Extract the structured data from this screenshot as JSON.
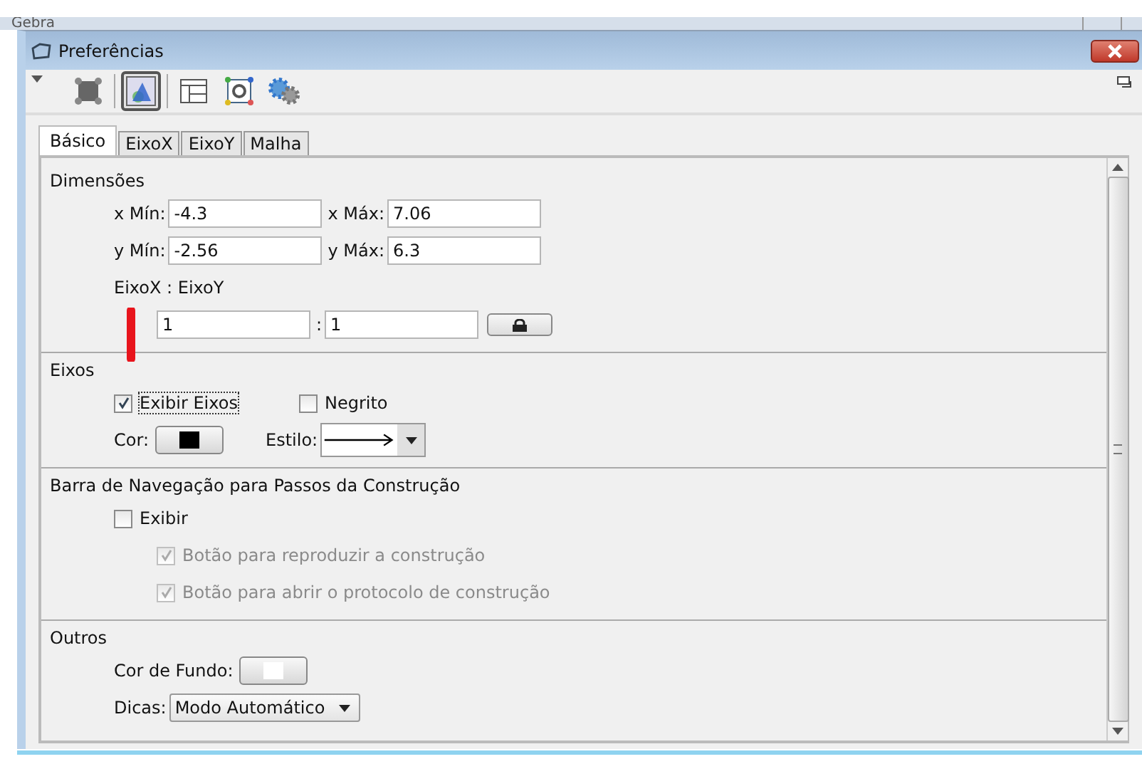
{
  "app_title": "Gebra",
  "window": {
    "title": "Preferências"
  },
  "toolbar": [
    {
      "kind": "points",
      "selected": false
    },
    {
      "kind": "graphics",
      "selected": true
    },
    {
      "kind": "layout",
      "selected": false
    },
    {
      "kind": "defaults",
      "selected": false
    },
    {
      "kind": "advanced",
      "selected": false
    }
  ],
  "tabs": [
    {
      "label": "Básico",
      "selected": true
    },
    {
      "label": "EixoX",
      "selected": false
    },
    {
      "label": "EixoY",
      "selected": false
    },
    {
      "label": "Malha",
      "selected": false
    }
  ],
  "sections": [
    {
      "title": "Dimensões",
      "rows": [
        {
          "kind": "main",
          "items": [
            {
              "kind": "label",
              "text": "x Mín:"
            },
            {
              "kind": "field",
              "value": "-4.3"
            },
            {
              "kind": "label",
              "text": "x Máx:"
            },
            {
              "kind": "field",
              "value": "7.06"
            }
          ]
        },
        {
          "kind": "main",
          "items": [
            {
              "kind": "label",
              "text": "y Mín:"
            },
            {
              "kind": "field",
              "value": "-2.56"
            },
            {
              "kind": "label",
              "text": "y Máx:"
            },
            {
              "kind": "field",
              "value": "6.3"
            }
          ]
        },
        {
          "kind": "main",
          "items": [
            {
              "kind": "label",
              "text": "EixoX : EixoY"
            }
          ]
        },
        {
          "kind": "sub",
          "items": [
            {
              "kind": "field",
              "value": "1"
            },
            {
              "kind": "label",
              "text": ":"
            },
            {
              "kind": "field",
              "value": "1"
            },
            {
              "kind": "lock"
            }
          ]
        }
      ]
    },
    {
      "title": "Eixos",
      "rows": [
        {
          "kind": "main",
          "items": [
            {
              "kind": "checkbox",
              "text": "Exibir Eixos",
              "checked": true,
              "disabled": false,
              "focused": true
            },
            {
              "kind": "checkbox",
              "text": "Negrito",
              "checked": false,
              "disabled": false,
              "focused": false
            }
          ]
        },
        {
          "kind": "main",
          "items": [
            {
              "kind": "label",
              "text": "Cor:"
            },
            {
              "kind": "color",
              "color": "#000000"
            },
            {
              "kind": "label",
              "text": "Estilo:"
            },
            {
              "kind": "style"
            }
          ]
        }
      ]
    },
    {
      "title": "Barra de Navegação para Passos da Construção",
      "rows": [
        {
          "kind": "main",
          "items": [
            {
              "kind": "checkbox",
              "text": "Exibir",
              "checked": false,
              "disabled": false,
              "focused": false
            }
          ]
        },
        {
          "kind": "sub",
          "items": [
            {
              "kind": "checkbox",
              "text": "Botão para reproduzir a construção",
              "checked": true,
              "disabled": true,
              "focused": false
            }
          ]
        },
        {
          "kind": "sub",
          "items": [
            {
              "kind": "checkbox",
              "text": "Botão para abrir o protocolo de construção",
              "checked": true,
              "disabled": true,
              "focused": false
            }
          ]
        }
      ]
    },
    {
      "title": "Outros",
      "rows": [
        {
          "kind": "main",
          "items": [
            {
              "kind": "label",
              "text": "Cor de Fundo:"
            },
            {
              "kind": "color",
              "color": "#ffffff"
            }
          ]
        },
        {
          "kind": "main",
          "items": [
            {
              "kind": "label",
              "text": "Dicas:"
            },
            {
              "kind": "dropdown",
              "value": "Modo Automático"
            }
          ]
        }
      ]
    }
  ]
}
